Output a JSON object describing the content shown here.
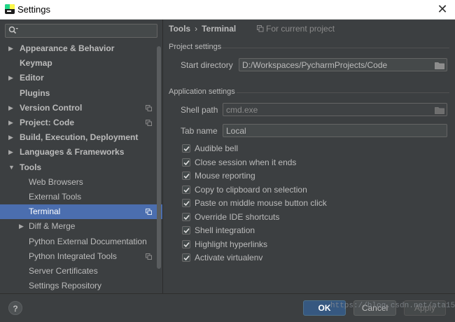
{
  "window": {
    "title": "Settings",
    "close_glyph": "✕"
  },
  "search": {
    "placeholder": "",
    "value": ""
  },
  "sidebar": {
    "items": [
      {
        "label": "Appearance & Behavior",
        "bold": true,
        "arrow": "right",
        "copy_icon": false,
        "level": 0
      },
      {
        "label": "Keymap",
        "bold": true,
        "arrow": "none",
        "copy_icon": false,
        "level": 0
      },
      {
        "label": "Editor",
        "bold": true,
        "arrow": "right",
        "copy_icon": false,
        "level": 0
      },
      {
        "label": "Plugins",
        "bold": true,
        "arrow": "none",
        "copy_icon": false,
        "level": 0
      },
      {
        "label": "Version Control",
        "bold": true,
        "arrow": "right",
        "copy_icon": true,
        "level": 0
      },
      {
        "label": "Project: Code",
        "bold": true,
        "arrow": "right",
        "copy_icon": true,
        "level": 0
      },
      {
        "label": "Build, Execution, Deployment",
        "bold": true,
        "arrow": "right",
        "copy_icon": false,
        "level": 0
      },
      {
        "label": "Languages & Frameworks",
        "bold": true,
        "arrow": "right",
        "copy_icon": false,
        "level": 0
      },
      {
        "label": "Tools",
        "bold": true,
        "arrow": "down",
        "copy_icon": false,
        "level": 0
      },
      {
        "label": "Web Browsers",
        "bold": false,
        "arrow": "none",
        "copy_icon": false,
        "level": 1
      },
      {
        "label": "External Tools",
        "bold": false,
        "arrow": "none",
        "copy_icon": false,
        "level": 1
      },
      {
        "label": "Terminal",
        "bold": false,
        "arrow": "none",
        "copy_icon": true,
        "level": 1,
        "selected": true
      },
      {
        "label": "Diff & Merge",
        "bold": false,
        "arrow": "right",
        "copy_icon": false,
        "level": 1
      },
      {
        "label": "Python External Documentation",
        "bold": false,
        "arrow": "none",
        "copy_icon": false,
        "level": 1
      },
      {
        "label": "Python Integrated Tools",
        "bold": false,
        "arrow": "none",
        "copy_icon": true,
        "level": 1
      },
      {
        "label": "Server Certificates",
        "bold": false,
        "arrow": "none",
        "copy_icon": false,
        "level": 1
      },
      {
        "label": "Settings Repository",
        "bold": false,
        "arrow": "none",
        "copy_icon": false,
        "level": 1
      }
    ]
  },
  "breadcrumb": {
    "parent": "Tools",
    "separator": "›",
    "current": "Terminal",
    "scope": "For current project"
  },
  "project_settings": {
    "title": "Project settings",
    "start_directory_label": "Start directory",
    "start_directory_value": "D:/Workspaces/PycharmProjects/Code"
  },
  "application_settings": {
    "title": "Application settings",
    "shell_path_label": "Shell path",
    "shell_path_value": "cmd.exe",
    "tab_name_label": "Tab name",
    "tab_name_value": "Local",
    "options": [
      {
        "label": "Audible bell",
        "checked": true
      },
      {
        "label": "Close session when it ends",
        "checked": true
      },
      {
        "label": "Mouse reporting",
        "checked": true
      },
      {
        "label": "Copy to clipboard on selection",
        "checked": true
      },
      {
        "label": "Paste on middle mouse button click",
        "checked": true
      },
      {
        "label": "Override IDE shortcuts",
        "checked": true
      },
      {
        "label": "Shell integration",
        "checked": true
      },
      {
        "label": "Highlight hyperlinks",
        "checked": true
      },
      {
        "label": "Activate virtualenv",
        "checked": true
      }
    ]
  },
  "footer": {
    "help_label": "?",
    "ok_label": "OK",
    "cancel_label": "Cancel",
    "apply_label": "Apply",
    "watermark": "https://blog.csdn.net/ata15"
  },
  "colors": {
    "selection": "#4b6eaf",
    "background": "#3c3f41",
    "ok_button": "#365880",
    "text": "#bbbbbb"
  }
}
